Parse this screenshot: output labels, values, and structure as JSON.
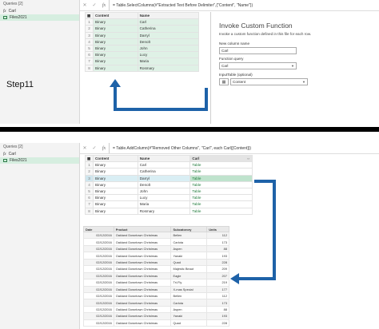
{
  "colors": {
    "accent": "#1e62a8",
    "selected_query": "#d6eee0",
    "green_rows": "#dff1e6"
  },
  "top": {
    "queries_header": "Queries [2]",
    "queries": [
      {
        "label": "Carl",
        "icon": "function-icon"
      },
      {
        "label": "Files2021",
        "icon": "table-icon"
      }
    ],
    "formula": "= Table.SelectColumns(#\"Extracted Text Before Delimiter\",{\"Content\", \"Name\"})",
    "columns": [
      "Content",
      "Name"
    ],
    "rows": [
      {
        "n": "1",
        "content": "Binary",
        "name": "Carl"
      },
      {
        "n": "2",
        "content": "Binary",
        "name": "Catherina"
      },
      {
        "n": "3",
        "content": "Binary",
        "name": "Darryl"
      },
      {
        "n": "4",
        "content": "Binary",
        "name": "Denolt"
      },
      {
        "n": "5",
        "content": "Binary",
        "name": "John"
      },
      {
        "n": "6",
        "content": "Binary",
        "name": "Lucy"
      },
      {
        "n": "7",
        "content": "Binary",
        "name": "Maria"
      },
      {
        "n": "8",
        "content": "Binary",
        "name": "Rosmary"
      }
    ],
    "dialog": {
      "title": "Invoke Custom Function",
      "description": "Invoke a custom function defined in this file for each row.",
      "new_column_label": "New column name",
      "new_column_value": "Carl",
      "function_query_label": "Function query",
      "function_query_value": "Carl",
      "input_table_label": "InputTable (optional)",
      "input_table_value": "Content"
    },
    "step_label": "Step11"
  },
  "bottom": {
    "queries_header": "Queries [2]",
    "queries": [
      {
        "label": "Carl",
        "icon": "function-icon"
      },
      {
        "label": "Files2021",
        "icon": "table-icon"
      }
    ],
    "formula": "= Table.AddColumn(#\"Removed Other Columns\", \"Carl\", each Carl([Content]))",
    "columns": [
      "Content",
      "Name",
      "Carl"
    ],
    "rows": [
      {
        "n": "1",
        "content": "Binary",
        "name": "Carl",
        "carl": "Table"
      },
      {
        "n": "2",
        "content": "Binary",
        "name": "Catherina",
        "carl": "Table"
      },
      {
        "n": "3",
        "content": "Binary",
        "name": "Darryl",
        "carl": "Table"
      },
      {
        "n": "4",
        "content": "Binary",
        "name": "Denolt",
        "carl": "Table"
      },
      {
        "n": "5",
        "content": "Binary",
        "name": "John",
        "carl": "Table"
      },
      {
        "n": "6",
        "content": "Binary",
        "name": "Lucy",
        "carl": "Table"
      },
      {
        "n": "7",
        "content": "Binary",
        "name": "Maria",
        "carl": "Table"
      },
      {
        "n": "8",
        "content": "Binary",
        "name": "Rosmary",
        "carl": "Table"
      }
    ],
    "preview": {
      "columns": [
        "Date",
        "Product",
        "Subcatorory",
        "Units"
      ],
      "rows": [
        [
          "02/12/2016",
          "Oakland Downtown Christmas",
          "Bellen",
          "112"
        ],
        [
          "02/12/2016",
          "Oakland Downtown Christmas",
          "Carlota",
          "173"
        ],
        [
          "02/12/2016",
          "Oakland Downtown Christmas",
          "Aspen",
          "88"
        ],
        [
          "02/12/2016",
          "Oakland Downtown Christmas",
          "Yanaki",
          "193"
        ],
        [
          "02/12/2016",
          "Oakland Downtown Christmas",
          "Quad",
          "228"
        ],
        [
          "02/12/2016",
          "Oakland Downtown Christmas",
          "Majestic Beaut",
          "209"
        ],
        [
          "02/12/2016",
          "Oakland Downtown Christmas",
          "Eagle",
          "207"
        ],
        [
          "02/12/2016",
          "Oakland Downtown Christmas",
          "Tri-Fly",
          "219"
        ],
        [
          "02/12/2016",
          "Oakland Downtown Christmas",
          "X-mas Special",
          "177"
        ],
        [
          "02/12/2016",
          "Oakland Downtown Christmas",
          "Bellen",
          "112"
        ],
        [
          "02/12/2016",
          "Oakland Downtown Christmas",
          "Carlota",
          "173"
        ],
        [
          "02/12/2016",
          "Oakland Downtown Christmas",
          "Aspen",
          "88"
        ],
        [
          "02/12/2016",
          "Oakland Downtown Christmas",
          "Yanaki",
          "193"
        ],
        [
          "02/12/2016",
          "Oakland Downtown Christmas",
          "Quad",
          "228"
        ]
      ]
    }
  }
}
